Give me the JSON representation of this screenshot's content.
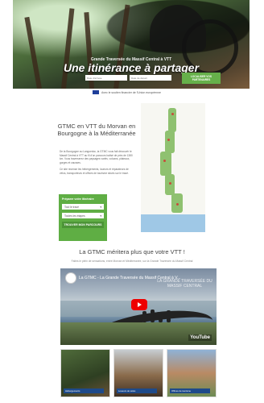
{
  "hero": {
    "kicker": "Grande Traversée du Massif Central à VTT",
    "title": "Une itinérance à partager",
    "form": {
      "start_placeholder": "Date d'arrivée",
      "end_placeholder": "Date de départ",
      "cta_label": "LOCALISER VOS PARTENAIRES"
    }
  },
  "eu_note": "Avec le soutien financier de l'Union européenne",
  "intro": {
    "title": "GTMC en VTT du Morvan en Bourgogne à la Méditerranée",
    "paragraphs": [
      "De la Bourgogne au Languedoc, la GTMC vous fait découvrir le Massif Central à VTT au fil d'un parcours balisé de près de 1380 km. Vous traverserez des paysages variés, volcans, plateaux, gorges et causses.",
      "Ce site recense les hébergements, loueurs et réparateurs de vélos, transporteurs et offices de tourisme situés sur le tracé."
    ]
  },
  "search": {
    "label": "Préparer votre itinéraire",
    "select_1": "Tout le tracé",
    "select_2": "Toutes les étapes",
    "button": "TROUVER MON PARCOURS"
  },
  "section2": {
    "title": "La GTMC méritera plus que votre VTT !",
    "subtitle": "Faites le plein de sensations, entre Morvan et Méditerranée, sur la Grande Traversée du Massif Central"
  },
  "video": {
    "title": "La GTMC - La Grande Traversée du Massif Central à V...",
    "overlay": "LA GRANDE TRAVERSÉE DU MASSIF CENTRAL",
    "platform": "YouTube"
  },
  "cards": [
    {
      "label": "Hébergements"
    },
    {
      "label": "Loueurs de vélos"
    },
    {
      "label": "Offices de tourisme"
    }
  ],
  "colors": {
    "accent_green": "#5fae44",
    "eu_blue": "#1f3f9a",
    "youtube_red": "#ee0000"
  }
}
